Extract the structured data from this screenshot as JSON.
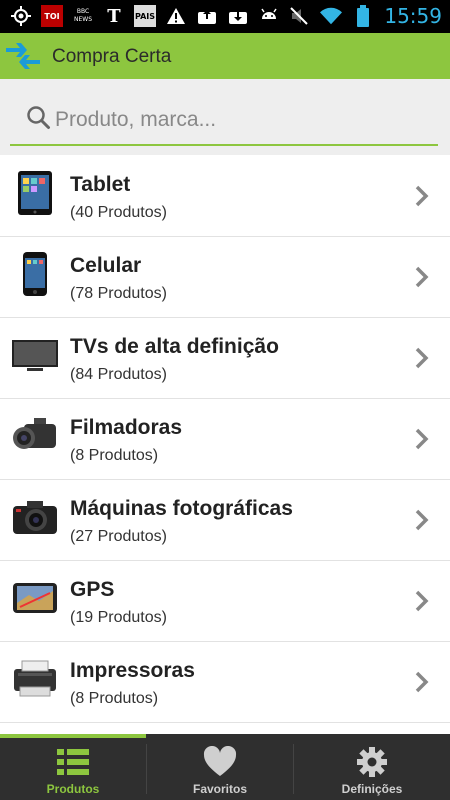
{
  "status_bar": {
    "time": "15:59",
    "icons": [
      "gps-icon",
      "toi-news-icon",
      "bbc-news-icon",
      "nyt-icon",
      "pais-icon",
      "warning-icon",
      "upload-icon",
      "download-icon",
      "android-icon",
      "mute-icon",
      "wifi-icon",
      "battery-icon"
    ],
    "toi_text": "TOI",
    "bbc_text": "BBC NEWS",
    "nyt_text": "T",
    "pais_text": "PAIS"
  },
  "app": {
    "title": "Compra Certa",
    "accent_color": "#8dc63f"
  },
  "search": {
    "placeholder": "Produto, marca..."
  },
  "categories": [
    {
      "title": "Tablet",
      "count": "(40 Produtos)",
      "icon": "tablet-icon"
    },
    {
      "title": "Celular",
      "count": "(78 Produtos)",
      "icon": "phone-icon"
    },
    {
      "title": "TVs de alta definição",
      "count": "(84 Produtos)",
      "icon": "tv-icon"
    },
    {
      "title": "Filmadoras",
      "count": "(8 Produtos)",
      "icon": "camcorder-icon"
    },
    {
      "title": "Máquinas fotográficas",
      "count": "(27 Produtos)",
      "icon": "camera-icon"
    },
    {
      "title": "GPS",
      "count": "(19 Produtos)",
      "icon": "gps-device-icon"
    },
    {
      "title": "Impressoras",
      "count": "(8 Produtos)",
      "icon": "printer-icon"
    }
  ],
  "bottom_nav": [
    {
      "label": "Produtos",
      "icon": "list-icon",
      "active": true
    },
    {
      "label": "Favoritos",
      "icon": "heart-icon",
      "active": false
    },
    {
      "label": "Definições",
      "icon": "gear-icon",
      "active": false
    }
  ]
}
